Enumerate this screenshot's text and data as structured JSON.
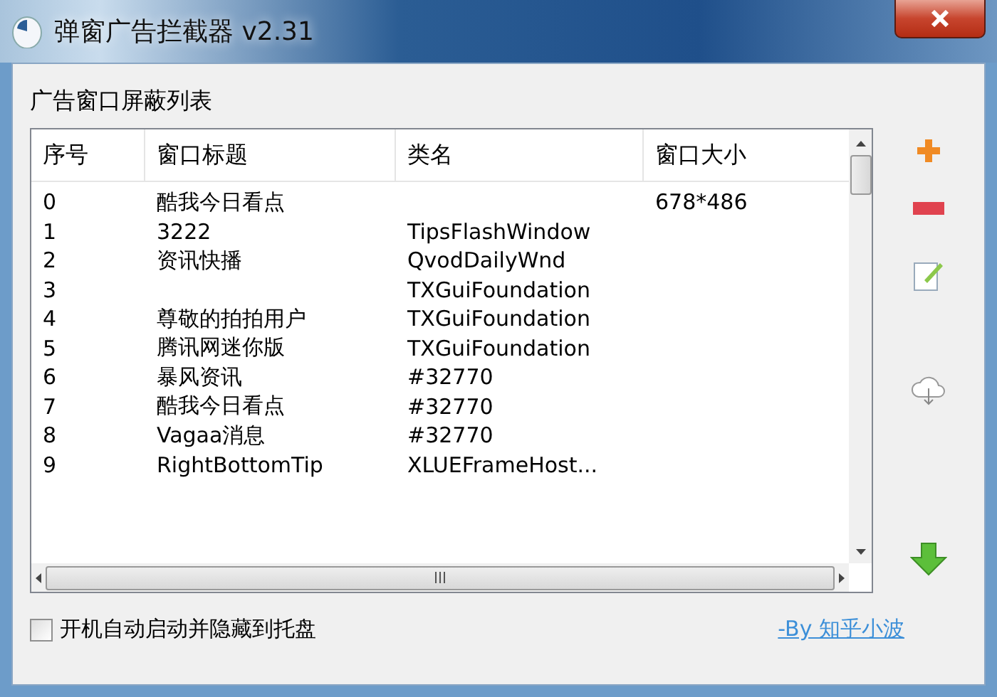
{
  "window": {
    "title": "弹窗广告拦截器 v2.31"
  },
  "list": {
    "label": "广告窗口屏蔽列表",
    "columns": [
      "序号",
      "窗口标题",
      "类名",
      "窗口大小"
    ],
    "rows": [
      {
        "index": "0",
        "title": "酷我今日看点",
        "class_name": "",
        "size": "678*486"
      },
      {
        "index": "1",
        "title": "3222",
        "class_name": "TipsFlashWindow",
        "size": ""
      },
      {
        "index": "2",
        "title": "资讯快播",
        "class_name": "QvodDailyWnd",
        "size": ""
      },
      {
        "index": "3",
        "title": "",
        "class_name": "TXGuiFoundation",
        "size": ""
      },
      {
        "index": "4",
        "title": "尊敬的拍拍用户",
        "class_name": "TXGuiFoundation",
        "size": ""
      },
      {
        "index": "5",
        "title": "腾讯网迷你版",
        "class_name": "TXGuiFoundation",
        "size": ""
      },
      {
        "index": "6",
        "title": "暴风资讯",
        "class_name": "#32770",
        "size": ""
      },
      {
        "index": "7",
        "title": "酷我今日看点",
        "class_name": "#32770",
        "size": ""
      },
      {
        "index": "8",
        "title": "Vagaa消息",
        "class_name": "#32770",
        "size": ""
      },
      {
        "index": "9",
        "title": "RightBottomTip",
        "class_name": "XLUEFrameHost...",
        "size": ""
      }
    ]
  },
  "autostart": {
    "label": "开机自动启动并隐藏到托盘",
    "checked": false
  },
  "credit_link": "-By 知乎小波"
}
